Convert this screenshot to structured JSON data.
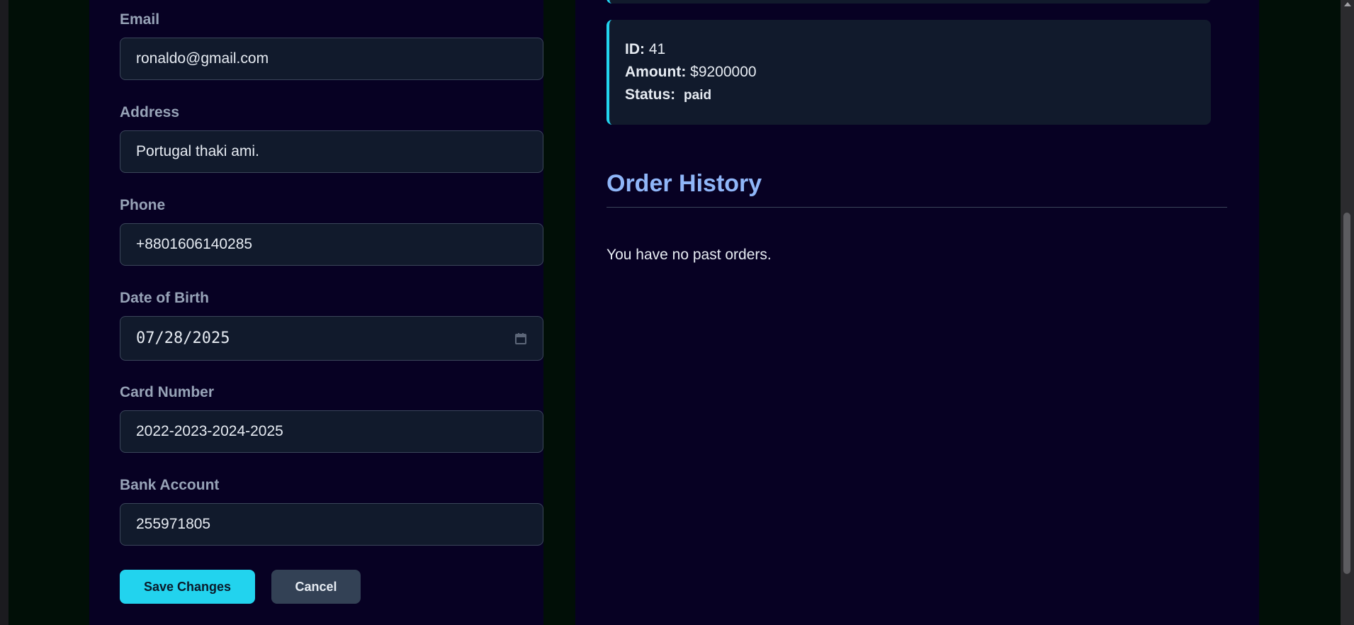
{
  "profile_form": {
    "fields": [
      {
        "label": "Email",
        "value": "ronaldo@gmail.com"
      },
      {
        "label": "Address",
        "value": "Portugal thaki ami."
      },
      {
        "label": "Phone",
        "value": "+8801606140285"
      },
      {
        "label": "Date of Birth",
        "value": "07/28/2025"
      },
      {
        "label": "Card Number",
        "value": "2022-2023-2024-2025"
      },
      {
        "label": "Bank Account",
        "value": "255971805"
      }
    ],
    "save_label": "Save Changes",
    "cancel_label": "Cancel"
  },
  "current_order": {
    "id_label": "ID:",
    "id_value": "41",
    "amount_label": "Amount:",
    "amount_value": "$9200000",
    "status_label": "Status:",
    "status_value": "paid"
  },
  "order_history": {
    "title": "Order History",
    "empty_message": "You have no past orders."
  },
  "colors": {
    "accent": "#22d3ee",
    "panel_bg": "#070123",
    "input_bg": "#111a2c",
    "heading": "#8fb6f8"
  }
}
